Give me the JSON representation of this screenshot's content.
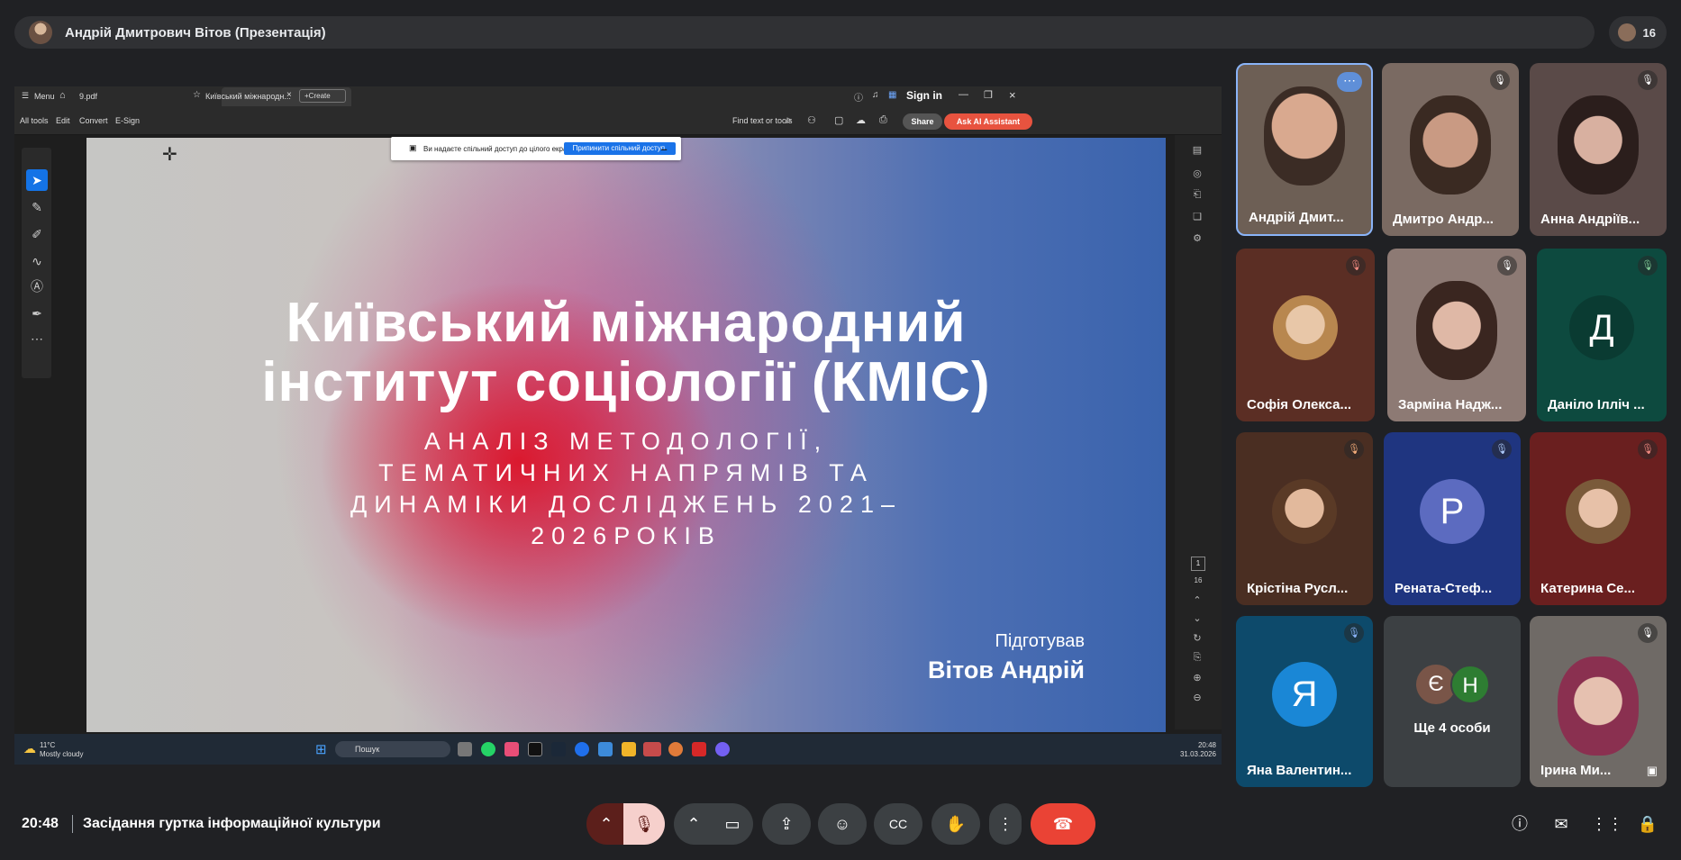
{
  "meeting_header": {
    "presenter_title": "Андрій Дмитрович Вітов (Презентація)",
    "participant_count": "16"
  },
  "acrobat": {
    "menu_label": "Menu",
    "tab_file": "9.pdf",
    "tab_active": "Київський міжнародн...",
    "create_label": "Create",
    "sign_in": "Sign in",
    "toolbar": {
      "all_tools": "All tools",
      "edit": "Edit",
      "convert": "Convert",
      "esign": "E-Sign",
      "find": "Find text or tools",
      "share": "Share",
      "ask_ai": "Ask AI Assistant"
    },
    "page_current": "1",
    "page_total": "16"
  },
  "share_banner": {
    "text": "Ви надаєте спільний доступ до цілого екрана.",
    "stop": "Припинити спільний доступ."
  },
  "slide": {
    "title_line1": "Київський міжнародний",
    "title_line2": "інститут соціології (КМІС)",
    "subtitle_line1": "АНАЛІЗ МЕТОДОЛОГІЇ,",
    "subtitle_line2": "ТЕМАТИЧНИХ НАПРЯМІВ ТА",
    "subtitle_line3": "ДИНАМІКИ ДОСЛІДЖЕНЬ 2021–",
    "subtitle_line4": "2026РОКІВ",
    "prepared_label": "Підготував",
    "author": "Вітов Андрій"
  },
  "taskbar": {
    "temp": "11°C",
    "weather": "Mostly cloudy",
    "search": "Пошук",
    "time": "20:48",
    "date": "31.03.2026"
  },
  "participants": [
    {
      "name": "Андрій Дмит...",
      "color": "#6d5f55"
    },
    {
      "name": "Дмитро Андр...",
      "color": "#7a6a62"
    },
    {
      "name": "Анна Андріїв...",
      "color": "#5a4a48"
    },
    {
      "name": "Софія Олекса...",
      "color": "#5b2e24"
    },
    {
      "name": "Зарміна Надж...",
      "color": "#8d7a74"
    },
    {
      "name": "Даніло Ілліч ...",
      "letter": "Д",
      "color": "#0d4a3f",
      "avatar_color": "#0a3b32"
    },
    {
      "name": "Крістіна Русл...",
      "color": "#4a2e22"
    },
    {
      "name": "Рената-Стеф...",
      "letter": "Р",
      "color": "#1f3580",
      "avatar_color": "#5c6bc0"
    },
    {
      "name": "Катерина Се...",
      "color": "#6a1f1f"
    },
    {
      "name": "Яна Валентин...",
      "letter": "Я",
      "color": "#0d4a6b",
      "avatar_color": "#1a87d6"
    },
    {
      "name": "Ще 4 особи",
      "letters": [
        "Є",
        "Н"
      ]
    },
    {
      "name": "Ірина Ми...",
      "color": "#6f6a66"
    }
  ],
  "bottom_bar": {
    "time": "20:48",
    "meeting_title": "Засідання гуртка інформаційної культури"
  }
}
